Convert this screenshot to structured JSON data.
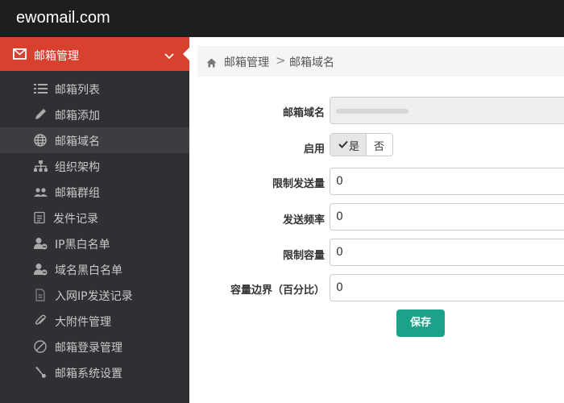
{
  "app": {
    "brand": "ewomail.com"
  },
  "sidebar": {
    "section": {
      "label": "邮箱管理",
      "icon": "envelope-icon",
      "chevron": "chevron-down-icon"
    },
    "items": [
      {
        "label": "邮箱列表",
        "icon": "list-icon"
      },
      {
        "label": "邮箱添加",
        "icon": "pencil-icon"
      },
      {
        "label": "邮箱域名",
        "icon": "globe-icon",
        "active": true
      },
      {
        "label": "组织架构",
        "icon": "sitemap-icon"
      },
      {
        "label": "邮箱群组",
        "icon": "users-icon"
      },
      {
        "label": "发件记录",
        "icon": "records-icon"
      },
      {
        "label": "IP黑白名单",
        "icon": "user-block-icon"
      },
      {
        "label": "域名黑白名单",
        "icon": "user-block-icon"
      },
      {
        "label": "入网IP发送记录",
        "icon": "file-icon"
      },
      {
        "label": "大附件管理",
        "icon": "paperclip-icon"
      },
      {
        "label": "邮箱登录管理",
        "icon": "ban-icon"
      },
      {
        "label": "邮箱系统设置",
        "icon": "wrench-icon"
      }
    ]
  },
  "breadcrumb": {
    "home_icon": "home-icon",
    "parent": "邮箱管理",
    "separator": ">",
    "current": "邮箱域名"
  },
  "form": {
    "domain_label": "邮箱域名",
    "enable_label": "启用",
    "enable_yes": "是",
    "enable_no": "否",
    "enable_selected": "是",
    "send_limit_label": "限制发送量",
    "send_limit_value": "0",
    "send_freq_label": "发送频率",
    "send_freq_value": "0",
    "capacity_label": "限制容量",
    "capacity_value": "0",
    "capacity_bound_label": "容量边界（百分比）",
    "capacity_bound_value": "0",
    "save_label": "保存"
  },
  "colors": {
    "accent": "#d8402f",
    "save": "#1aa38a",
    "sidebar": "#2f3033",
    "topbar": "#1e1e1e"
  }
}
